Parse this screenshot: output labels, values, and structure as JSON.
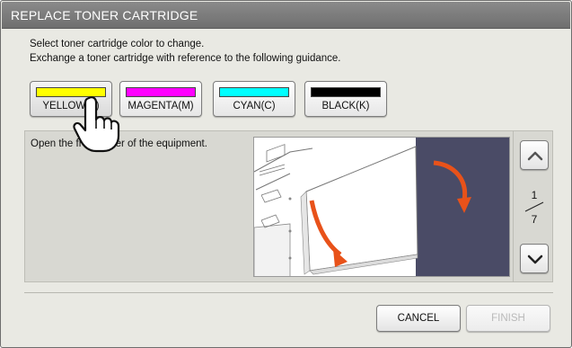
{
  "window": {
    "title": "REPLACE TONER CARTRIDGE"
  },
  "instructions": [
    "Select toner cartridge color to change.",
    "Exchange a toner cartridge with reference to the following guidance."
  ],
  "color_buttons": [
    {
      "label": "YELLOW(Y)",
      "swatch": "#ffff00",
      "selected": true
    },
    {
      "label": "MAGENTA(M)",
      "swatch": "#ff00ff",
      "selected": false
    },
    {
      "label": "CYAN(C)",
      "swatch": "#00ffff",
      "selected": false
    },
    {
      "label": "BLACK(K)",
      "swatch": "#000000",
      "selected": false
    }
  ],
  "guide": {
    "step_text": "Open the front cover of the equipment."
  },
  "pager": {
    "current": "1",
    "total": "7",
    "up_icon": "chevron-up-icon",
    "down_icon": "chevron-down-icon"
  },
  "actions": {
    "cancel_label": "CANCEL",
    "finish_label": "FINISH",
    "finish_enabled": false
  },
  "colors": {
    "arrow": "#e8521a",
    "machine_bg": "#4a4b66"
  }
}
